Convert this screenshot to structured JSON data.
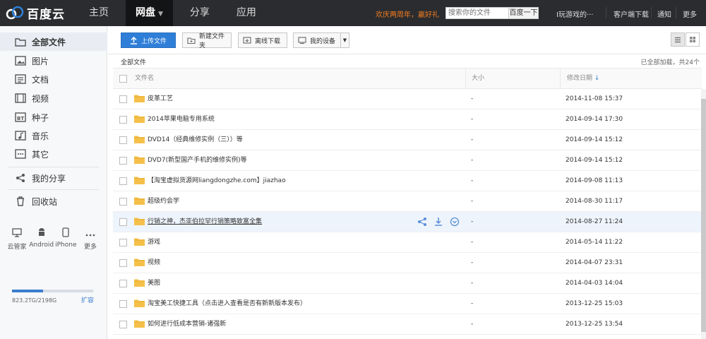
{
  "header": {
    "logo_text": "百度云",
    "nav": [
      {
        "label": "主页",
        "active": false
      },
      {
        "label": "网盘",
        "active": true
      },
      {
        "label": "分享",
        "active": false
      },
      {
        "label": "应用",
        "active": false
      }
    ],
    "promo": "欢庆两周年，赢好礼",
    "search": {
      "placeholder": "搜索你的文件",
      "button": "百度一下"
    },
    "user": "I玩游戏的···",
    "links": [
      "客户端下载",
      "通知",
      "更多"
    ]
  },
  "sidebar": {
    "items": [
      {
        "label": "全部文件",
        "icon": "folder-icon",
        "active": true
      },
      {
        "label": "图片",
        "icon": "image-icon"
      },
      {
        "label": "文档",
        "icon": "document-icon"
      },
      {
        "label": "视频",
        "icon": "video-icon"
      },
      {
        "label": "种子",
        "icon": "torrent-icon"
      },
      {
        "label": "音乐",
        "icon": "music-icon"
      },
      {
        "label": "其它",
        "icon": "more-icon"
      },
      {
        "label": "我的分享",
        "icon": "share-icon"
      },
      {
        "label": "回收站",
        "icon": "trash-icon"
      }
    ],
    "devices": [
      {
        "label": "云管家",
        "icon": "monitor-icon"
      },
      {
        "label": "Android",
        "icon": "android-icon"
      },
      {
        "label": "iPhone",
        "icon": "iphone-icon"
      },
      {
        "label": "更多",
        "icon": "more-dots-icon"
      }
    ],
    "quota": {
      "text": "823.2TG/2198G",
      "expand": "扩容",
      "used_fraction": 0.38
    }
  },
  "toolbar": {
    "upload": "上传文件",
    "new_folder": "新建文件夹",
    "offline": "离线下载",
    "devices": "我的设备"
  },
  "breadcrumb": "全部文件",
  "count_text": "已全部加载，共24个",
  "table": {
    "headers": {
      "name": "文件名",
      "size": "大小",
      "date": "修改日期"
    },
    "rows": [
      {
        "name": "皮革工艺",
        "size": "-",
        "date": "2014-11-08 15:37"
      },
      {
        "name": "2014苹果电脑专用系统",
        "size": "-",
        "date": "2014-09-14 17:30"
      },
      {
        "name": "DVD14（经典维修实例（三））等",
        "size": "-",
        "date": "2014-09-14 15:12"
      },
      {
        "name": "DVD7(新型国产手机的维修实例)等",
        "size": "-",
        "date": "2014-09-14 15:12"
      },
      {
        "name": "【淘宝虚拟货源网liangdongzhe.com】jiazhao",
        "size": "-",
        "date": "2014-09-08 11:13"
      },
      {
        "name": "超级约会学",
        "size": "-",
        "date": "2014-08-30 11:17"
      },
      {
        "name": "行销之神，杰亚伯拉罕行销策略致富全集",
        "size": "-",
        "date": "2014-08-27 11:24",
        "hover": true
      },
      {
        "name": "游戏",
        "size": "-",
        "date": "2014-05-14 11:22"
      },
      {
        "name": "视频",
        "size": "-",
        "date": "2014-04-07 23:31"
      },
      {
        "name": "美图",
        "size": "-",
        "date": "2014-04-03 14:04"
      },
      {
        "name": "淘宝美工快捷工具（点击进入查看是否有新新版本发布）",
        "size": "-",
        "date": "2013-12-25 15:03"
      },
      {
        "name": "如何进行低成本营销-诸强新",
        "size": "-",
        "date": "2013-12-25 13:54"
      }
    ]
  },
  "colors": {
    "topbar": "#2a2c2f",
    "accent": "#2f7fd8",
    "folder": "#f5c04a",
    "promo": "#f07b20"
  }
}
